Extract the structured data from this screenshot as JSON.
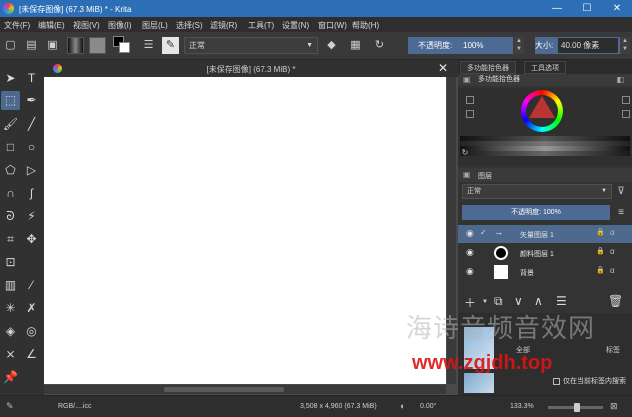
{
  "window": {
    "title": "[未保存图像] (67.3 MiB) * - Krita",
    "minimize": "—",
    "maximize": "☐",
    "close": "✕"
  },
  "menu": [
    "文件(F)",
    "编辑(E)",
    "视图(V)",
    "图像(I)",
    "图层(L)",
    "选择(S)",
    "滤镜(R)",
    "工具(T)",
    "设置(N)",
    "窗口(W)",
    "帮助(H)"
  ],
  "toolbar": {
    "blend_mode": "正常",
    "opacity_label": "不透明度:",
    "opacity_value": "100%",
    "size_label": "大小:",
    "size_value": "40.00 像素"
  },
  "document": {
    "tab_title": "[未保存图像] (67.3 MiB) *",
    "close": "✕"
  },
  "dock": {
    "tabs": [
      "多功能拾色器",
      "工具选项"
    ],
    "color_panel_title": "多功能拾色器",
    "layers_panel_title": "图层",
    "layer_blend": "正常",
    "layer_opacity": "不透明度: 100%",
    "layers": [
      {
        "name": "矢量图层 1",
        "selected": true
      },
      {
        "name": "颜料图层 1",
        "selected": false
      },
      {
        "name": "背景",
        "selected": false
      }
    ],
    "brush": {
      "tag_label": "标签",
      "all_label": "全部",
      "search_in_tags": "仅在当前标签内搜索"
    }
  },
  "status": {
    "color_space": "RGB/....icc",
    "dimensions": "3,508 x 4,960 (67.3 MiB)",
    "rotation": "0.00°",
    "zoom": "133.3%"
  },
  "watermark": {
    "line1": "海诗音频音效网",
    "line2": "www.zgjdh.top"
  }
}
